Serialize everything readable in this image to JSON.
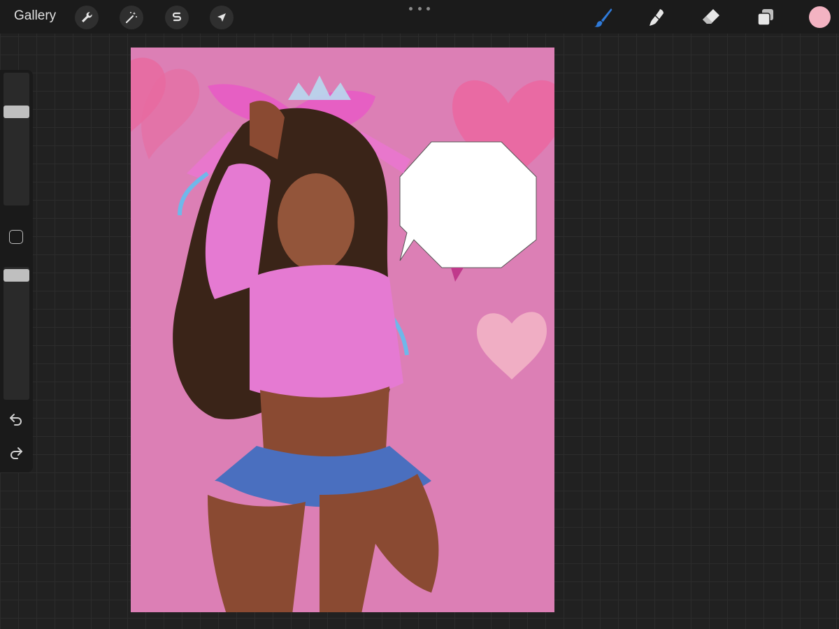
{
  "topbar": {
    "gallery_label": "Gallery",
    "left_tools": [
      {
        "name": "actions",
        "icon": "wrench-icon"
      },
      {
        "name": "adjustments",
        "icon": "magic-wand-icon"
      },
      {
        "name": "selection",
        "icon": "selection-s-icon"
      },
      {
        "name": "transform",
        "icon": "arrow-cursor-icon"
      }
    ],
    "right_tools": [
      {
        "name": "brush",
        "icon": "brush-icon",
        "active": true
      },
      {
        "name": "smudge",
        "icon": "smudge-icon",
        "active": false
      },
      {
        "name": "eraser",
        "icon": "eraser-icon",
        "active": false
      },
      {
        "name": "layers",
        "icon": "layers-icon",
        "active": false
      }
    ],
    "active_color": "#f3b3c2",
    "accent_color": "#2f7ad9"
  },
  "sidebar": {
    "brush_size_level": 0.18,
    "opacity_level": 0.6,
    "buttons": [
      "modify-button",
      "undo-icon",
      "redo-icon"
    ]
  },
  "canvas": {
    "background_color": "#dc7fb5",
    "artwork": "illustration"
  }
}
